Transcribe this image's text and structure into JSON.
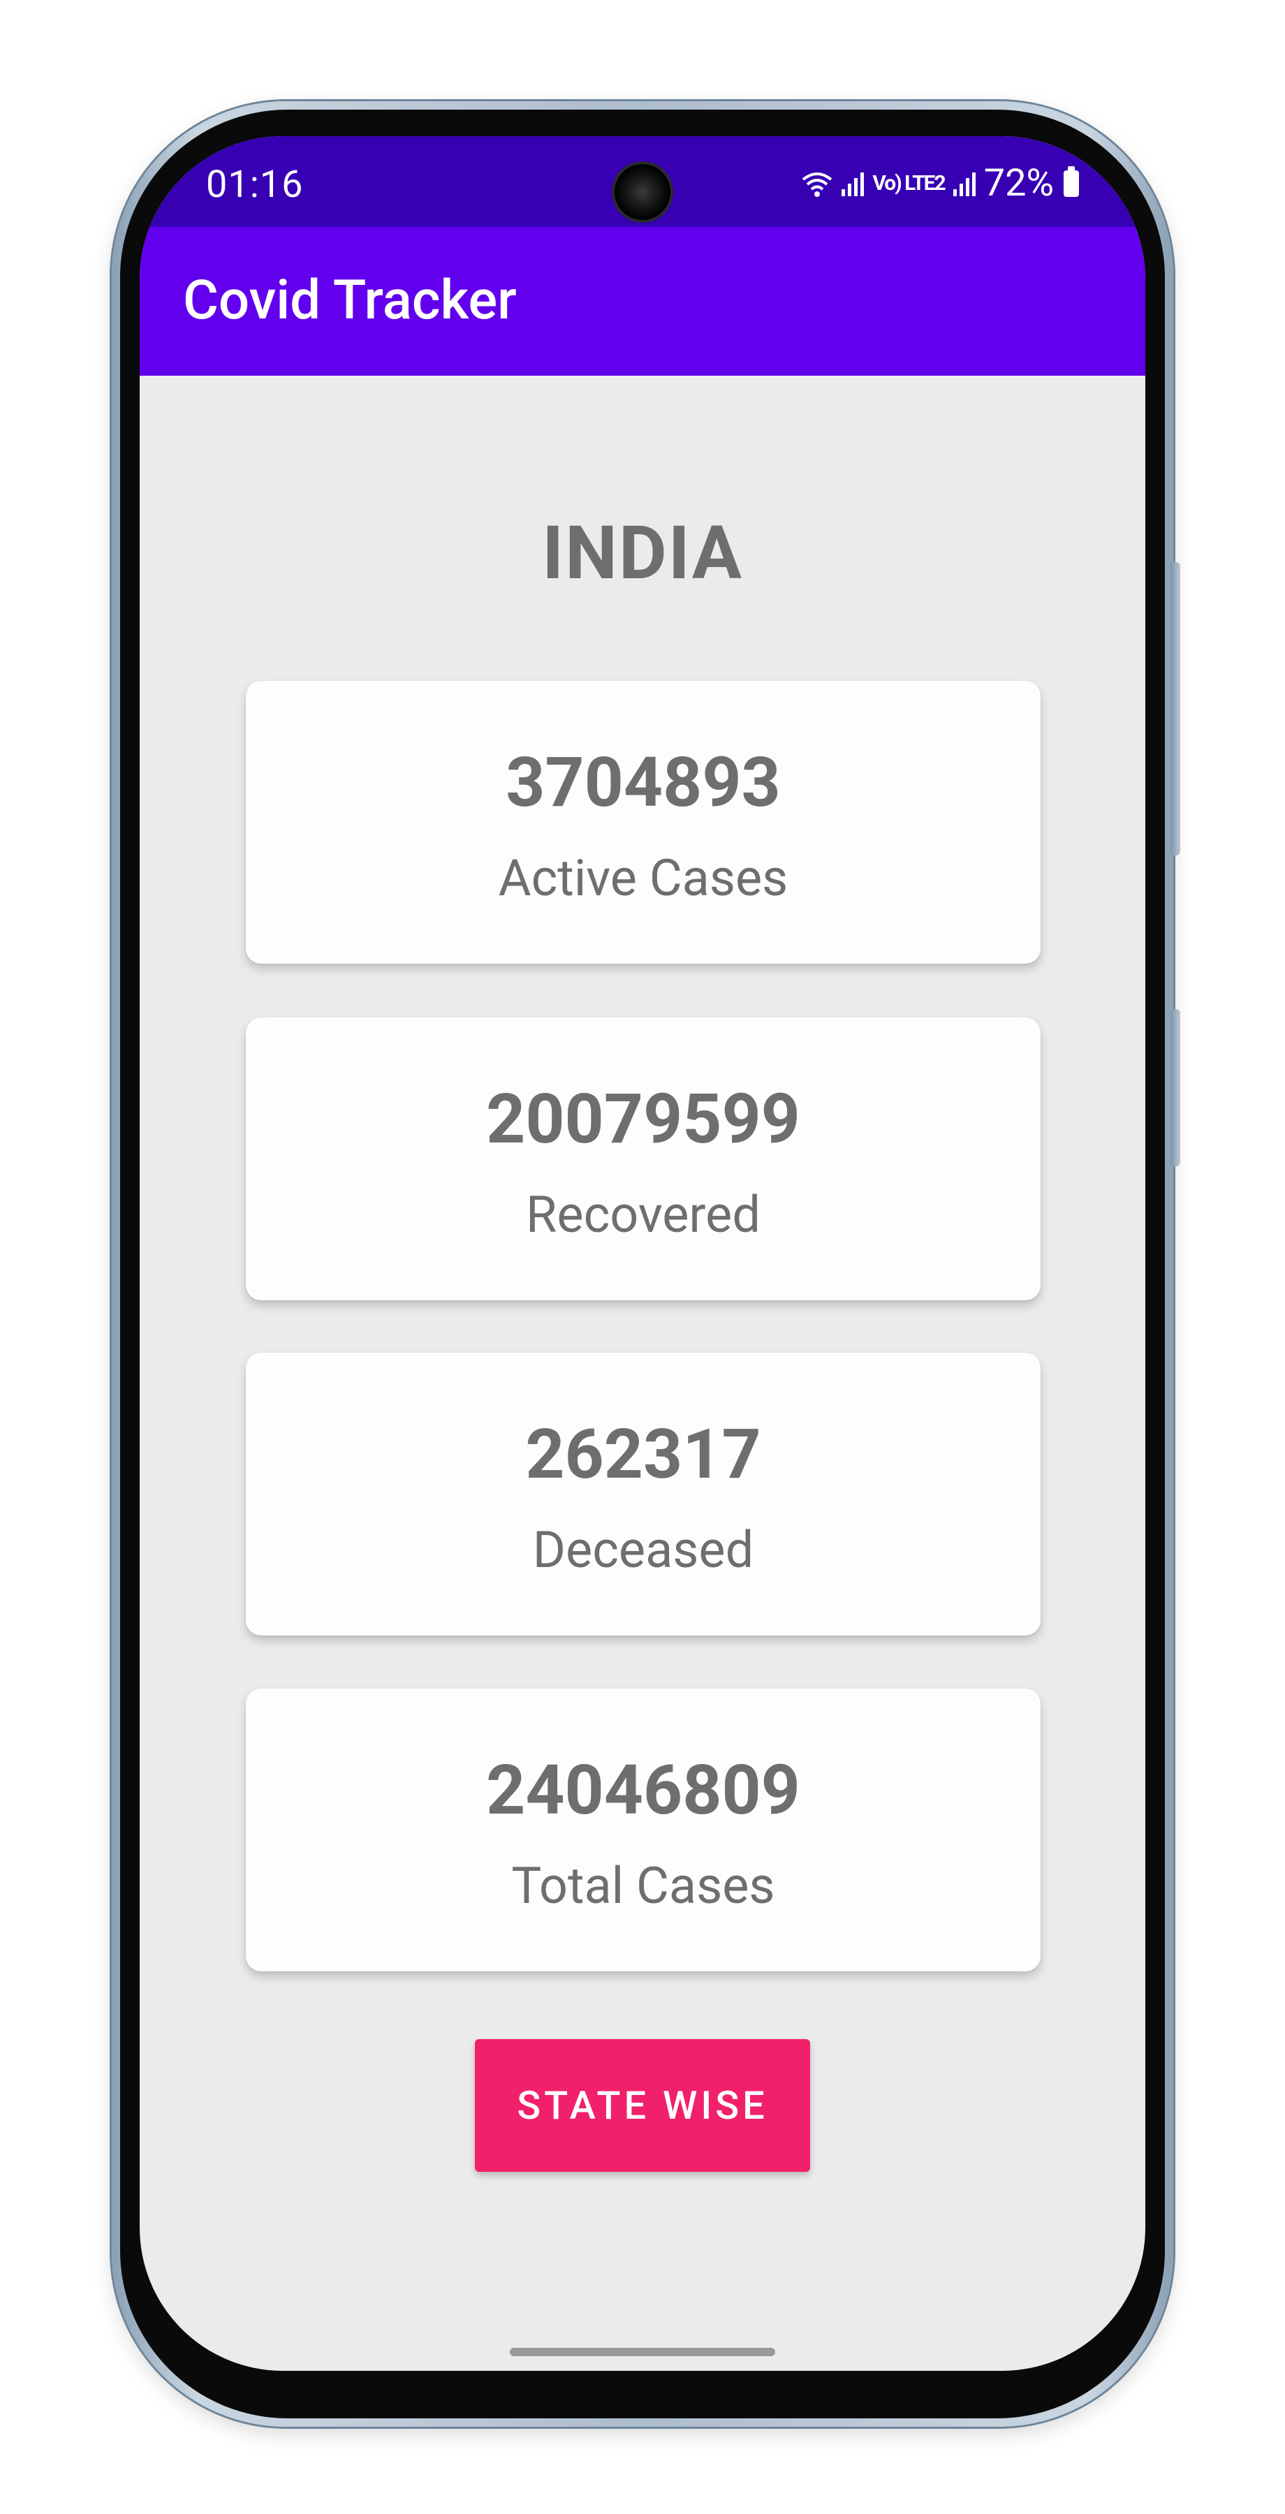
{
  "status_bar": {
    "time": "01:16",
    "wifi_icon": "wifi-icon",
    "network_text": "Vo) LTE2",
    "signal_icon": "signal-icon",
    "battery_percent": "72%",
    "battery_icon": "battery-icon"
  },
  "app_bar": {
    "title": "Covid Tracker"
  },
  "main": {
    "country": "INDIA",
    "stats": [
      {
        "value": "3704893",
        "label": "Active Cases"
      },
      {
        "value": "20079599",
        "label": "Recovered"
      },
      {
        "value": "262317",
        "label": "Deceased"
      },
      {
        "value": "24046809",
        "label": "Total Cases"
      }
    ],
    "state_button_label": "STATE WISE"
  },
  "colors": {
    "status_bar": "#3700b3",
    "app_bar": "#6200ee",
    "button": "#f1206a",
    "background": "#ebebeb",
    "text": "#6e6e6e"
  }
}
